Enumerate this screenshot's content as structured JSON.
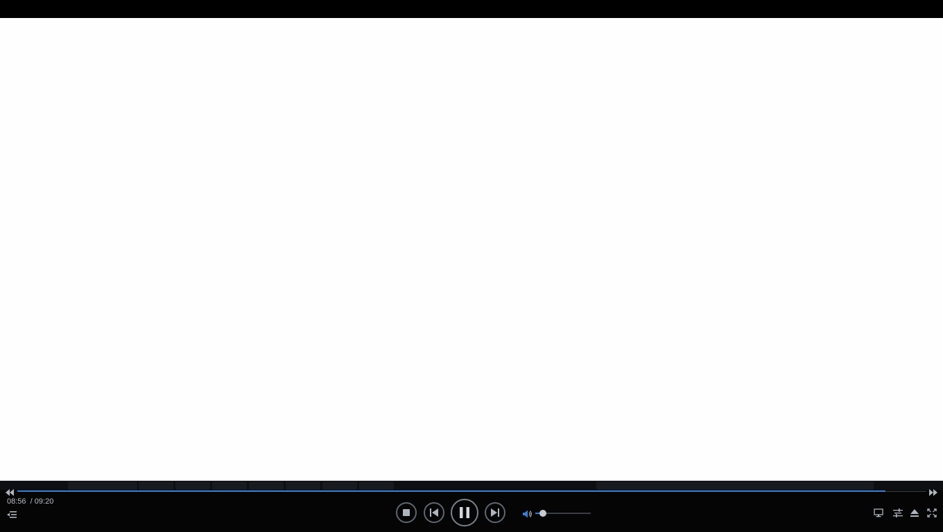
{
  "player": {
    "time": {
      "current": "08:56",
      "separator": "/",
      "total": "09:20"
    },
    "seek_progress": 0.955,
    "volume_level": 0.14,
    "is_playing": true,
    "icons": {
      "seek_back": "rewind-icon",
      "seek_forward": "fast-forward-icon",
      "playlist": "playlist-icon",
      "stop": "stop-icon",
      "previous": "previous-track-icon",
      "pause": "pause-icon",
      "next": "next-track-icon",
      "volume": "volume-icon",
      "display": "monitor-icon",
      "equalizer": "equalizer-icon",
      "eject": "eject-icon",
      "fullscreen": "fullscreen-icon"
    },
    "colors": {
      "accent": "#3b7fd4",
      "video_background": "#fefefe",
      "bar_background": "#050505",
      "icon": "#aeb5be"
    }
  }
}
